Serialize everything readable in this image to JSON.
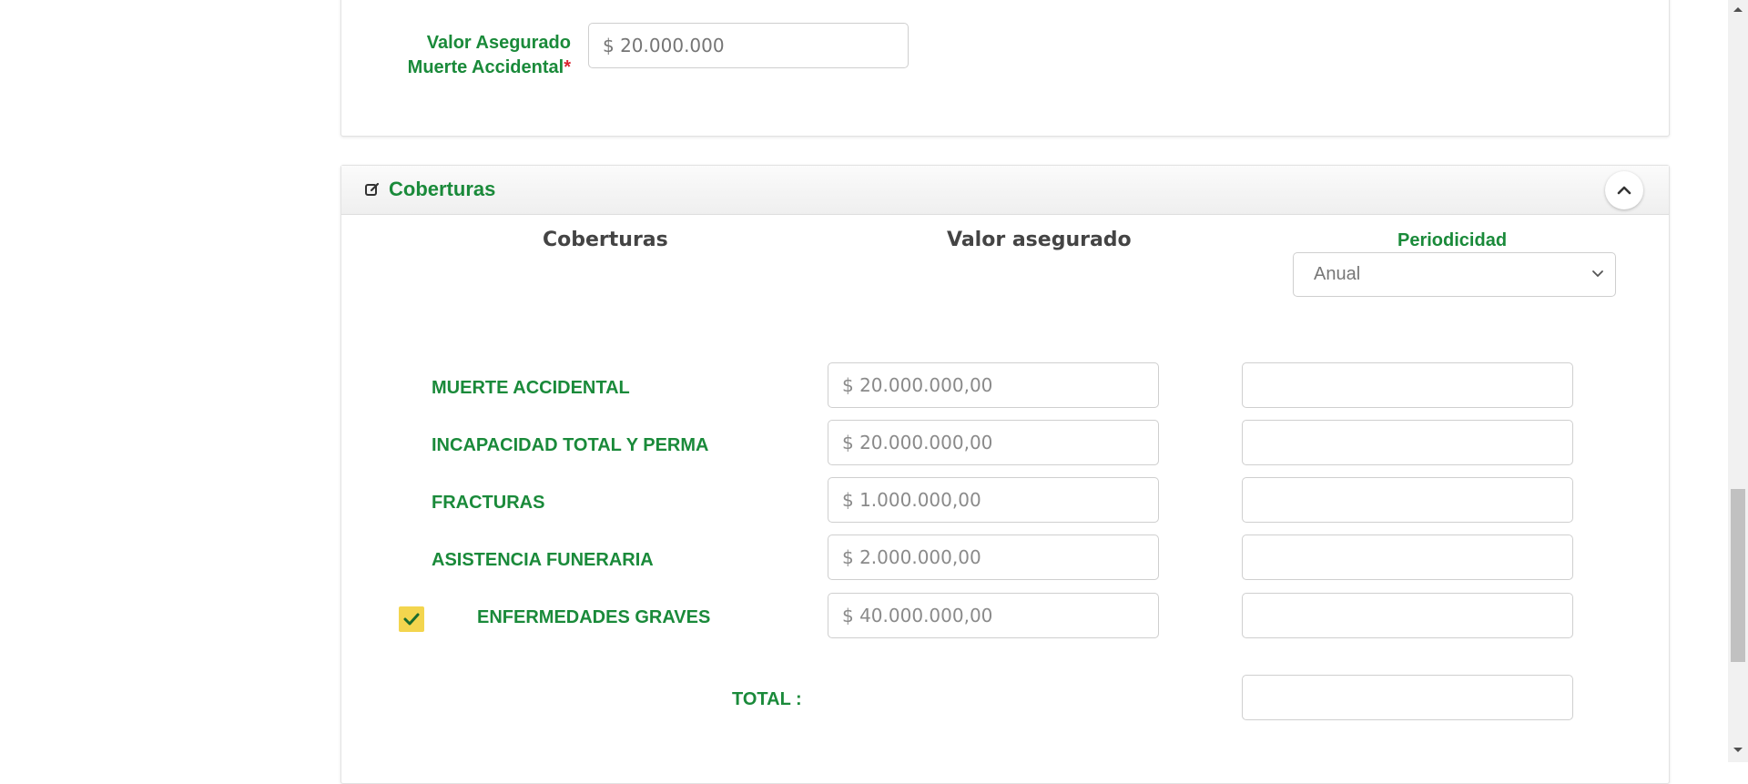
{
  "insured_value": {
    "label_line1": "Valor Asegurado",
    "label_line2": "Muerte Accidental",
    "required_mark": "*",
    "placeholder": "$ 20.000.000"
  },
  "coverage_panel": {
    "title": "Coberturas",
    "icons": {
      "edit": "edit-icon",
      "collapse": "chevron-up-icon"
    },
    "col_coberturas": "Coberturas",
    "col_valor": "Valor asegurado",
    "periodicidad_label": "Periodicidad",
    "periodicidad_selected": "Anual",
    "rows": [
      {
        "label": "MUERTE ACCIDENTAL",
        "value": "$ 20.000.000,00",
        "premium": ""
      },
      {
        "label": "INCAPACIDAD TOTAL Y PERMA",
        "value": "$ 20.000.000,00",
        "premium": ""
      },
      {
        "label": "FRACTURAS",
        "value": "$ 1.000.000,00",
        "premium": ""
      },
      {
        "label": "ASISTENCIA FUNERARIA",
        "value": "$ 2.000.000,00",
        "premium": ""
      },
      {
        "label": "ENFERMEDADES GRAVES",
        "value": "$ 40.000.000,00",
        "premium": "",
        "checked": true
      }
    ],
    "total_label": "TOTAL :",
    "total_value": ""
  },
  "colors": {
    "accent": "#1a8a3a",
    "required": "#d9232e",
    "checkbox": "#f3d54e"
  }
}
